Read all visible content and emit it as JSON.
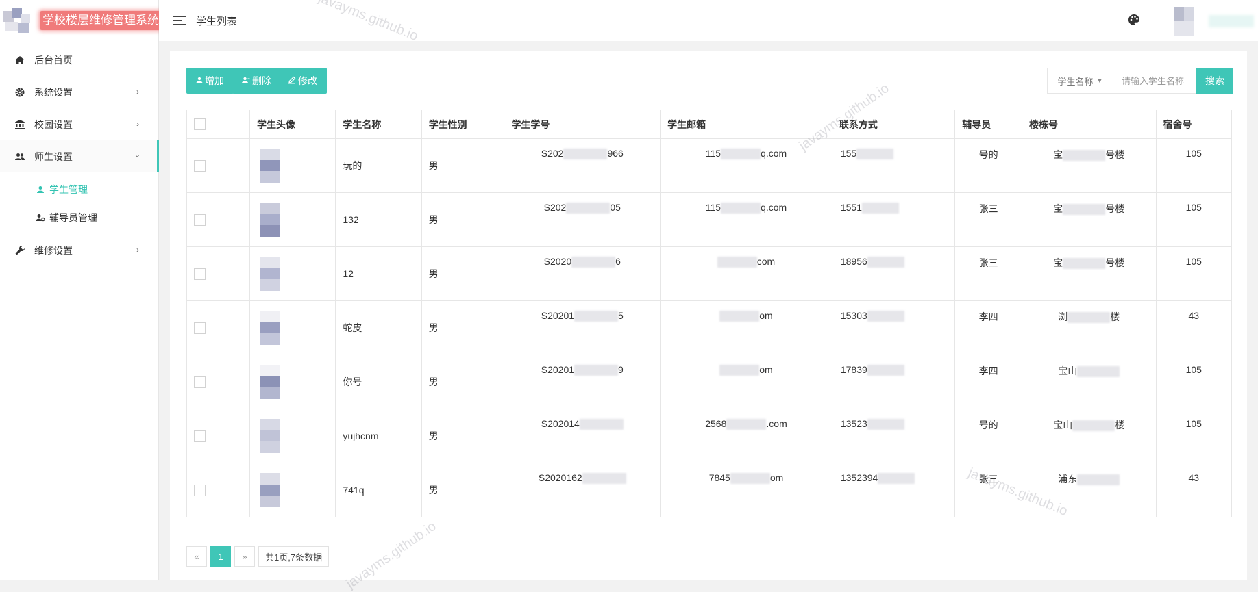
{
  "app": {
    "title": "学校楼层维修管理系统"
  },
  "header": {
    "page_title": "学生列表"
  },
  "sidebar": {
    "items": [
      {
        "label": "后台首页",
        "icon": "home-icon"
      },
      {
        "label": "系统设置",
        "icon": "gear-icon"
      },
      {
        "label": "校园设置",
        "icon": "bank-icon"
      },
      {
        "label": "师生设置",
        "icon": "users-icon",
        "expanded": true,
        "children": [
          {
            "label": "学生管理",
            "icon": "user-icon",
            "active": true
          },
          {
            "label": "辅导员管理",
            "icon": "user-cog-icon"
          }
        ]
      },
      {
        "label": "维修设置",
        "icon": "wrench-icon"
      }
    ]
  },
  "toolbar": {
    "add_label": "增加",
    "delete_label": "删除",
    "edit_label": "修改"
  },
  "search": {
    "field_label": "学生名称",
    "placeholder": "请输入学生名称",
    "button_label": "搜索"
  },
  "table": {
    "headers": [
      "学生头像",
      "学生名称",
      "学生性别",
      "学生学号",
      "学生邮箱",
      "联系方式",
      "辅导员",
      "楼栋号",
      "宿舍号"
    ],
    "rows": [
      {
        "name": "玩的",
        "gender": "男",
        "id_pre": "S202",
        "id_post": "966",
        "email_pre": "115",
        "email_post": "q.com",
        "phone": "155",
        "counselor": "号的",
        "building_pre": "宝",
        "building_post": "号楼",
        "room": "105"
      },
      {
        "name": "132",
        "gender": "男",
        "id_pre": "S202",
        "id_post": "05",
        "email_pre": "115",
        "email_post": "q.com",
        "phone": "1551",
        "counselor": "张三",
        "building_pre": "宝",
        "building_post": "号楼",
        "room": "105"
      },
      {
        "name": "12",
        "gender": "男",
        "id_pre": "S2020",
        "id_post": "6",
        "email_pre": "",
        "email_post": "com",
        "phone": "18956",
        "counselor": "张三",
        "building_pre": "宝",
        "building_post": "号楼",
        "room": "105"
      },
      {
        "name": "蛇皮",
        "gender": "男",
        "id_pre": "S20201",
        "id_post": "5",
        "email_pre": "",
        "email_post": "om",
        "phone": "15303",
        "counselor": "李四",
        "building_pre": "浏",
        "building_post": "楼",
        "room": "43"
      },
      {
        "name": "你号",
        "gender": "男",
        "id_pre": "S20201",
        "id_post": "9",
        "email_pre": "",
        "email_post": "om",
        "phone": "17839",
        "counselor": "李四",
        "building_pre": "宝山",
        "building_post": "",
        "room": "105"
      },
      {
        "name": "yujhcnm",
        "gender": "男",
        "id_pre": "S202014",
        "id_post": "",
        "email_pre": "2568",
        "email_post": ".com",
        "phone": "13523",
        "counselor": "号的",
        "building_pre": "宝山",
        "building_post": "楼",
        "room": "105"
      },
      {
        "name": "741q",
        "gender": "男",
        "id_pre": "S2020162",
        "id_post": "",
        "email_pre": "7845",
        "email_post": "om",
        "phone": "1352394",
        "counselor": "张三",
        "building_pre": "浦东",
        "building_post": "",
        "room": "43"
      }
    ]
  },
  "pagination": {
    "prev": "«",
    "current": "1",
    "next": "»",
    "info": "共1页,7条数据"
  },
  "watermark": "javayms.github.io",
  "colors": {
    "accent": "#3fc6b7",
    "title_bg": "#f07b7b"
  }
}
